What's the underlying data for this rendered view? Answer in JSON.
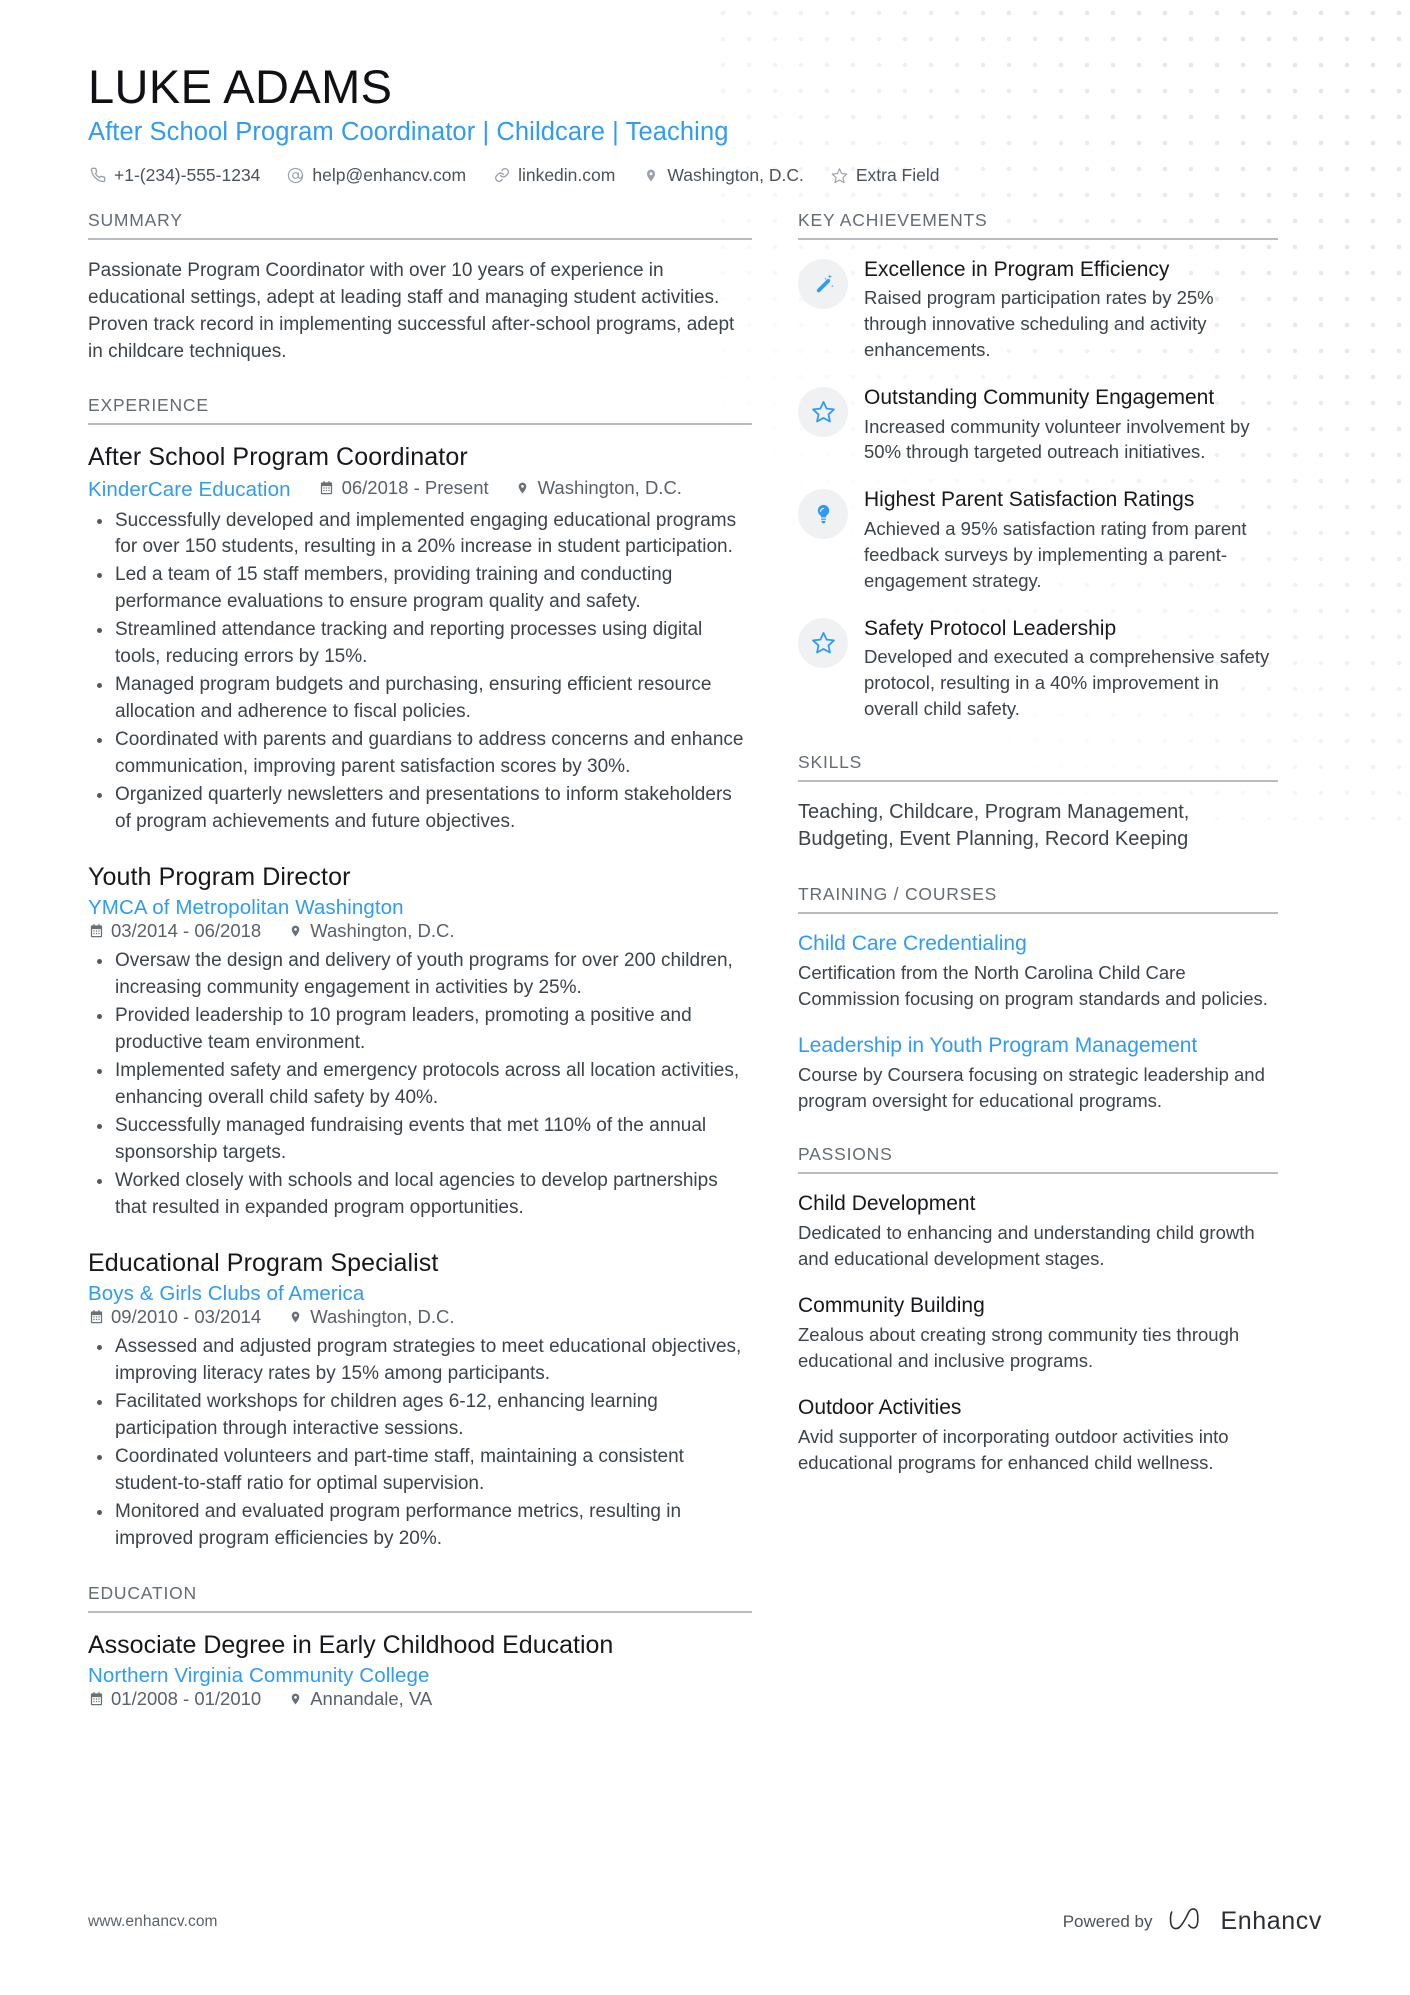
{
  "header": {
    "name": "LUKE ADAMS",
    "headline": "After School Program Coordinator | Childcare | Teaching",
    "contacts": [
      {
        "icon": "phone-icon",
        "text": "+1-(234)-555-1234"
      },
      {
        "icon": "email-icon",
        "text": "help@enhancv.com"
      },
      {
        "icon": "link-icon",
        "text": "linkedin.com"
      },
      {
        "icon": "location-icon",
        "text": "Washington, D.C."
      },
      {
        "icon": "star-icon",
        "text": "Extra Field"
      }
    ]
  },
  "summary": {
    "title": "SUMMARY",
    "text": "Passionate Program Coordinator with over 10 years of experience in educational settings, adept at leading staff and managing student activities. Proven track record in implementing successful after-school programs, adept in childcare techniques."
  },
  "experience": {
    "title": "EXPERIENCE",
    "jobs": [
      {
        "role": "After School Program Coordinator",
        "company": "KinderCare Education",
        "dates": "06/2018 - Present",
        "location": "Washington, D.C.",
        "inline_meta": true,
        "bullets": [
          "Successfully developed and implemented engaging educational programs for over 150 students, resulting in a 20% increase in student participation.",
          "Led a team of 15 staff members, providing training and conducting performance evaluations to ensure program quality and safety.",
          "Streamlined attendance tracking and reporting processes using digital tools, reducing errors by 15%.",
          "Managed program budgets and purchasing, ensuring efficient resource allocation and adherence to fiscal policies.",
          "Coordinated with parents and guardians to address concerns and enhance communication, improving parent satisfaction scores by 30%.",
          "Organized quarterly newsletters and presentations to inform stakeholders of program achievements and future objectives."
        ]
      },
      {
        "role": "Youth Program Director",
        "company": "YMCA of Metropolitan Washington",
        "dates": "03/2014 - 06/2018",
        "location": "Washington, D.C.",
        "inline_meta": false,
        "bullets": [
          "Oversaw the design and delivery of youth programs for over 200 children, increasing community engagement in activities by 25%.",
          "Provided leadership to 10 program leaders, promoting a positive and productive team environment.",
          "Implemented safety and emergency protocols across all location activities, enhancing overall child safety by 40%.",
          "Successfully managed fundraising events that met 110% of the annual sponsorship targets.",
          "Worked closely with schools and local agencies to develop partnerships that resulted in expanded program opportunities."
        ]
      },
      {
        "role": "Educational Program Specialist",
        "company": "Boys & Girls Clubs of America",
        "dates": "09/2010 - 03/2014",
        "location": "Washington, D.C.",
        "inline_meta": false,
        "bullets": [
          "Assessed and adjusted program strategies to meet educational objectives, improving literacy rates by 15% among participants.",
          "Facilitated workshops for children ages 6-12, enhancing learning participation through interactive sessions.",
          "Coordinated volunteers and part-time staff, maintaining a consistent student-to-staff ratio for optimal supervision.",
          "Monitored and evaluated program performance metrics, resulting in improved program efficiencies by 20%."
        ]
      }
    ]
  },
  "education": {
    "title": "EDUCATION",
    "entries": [
      {
        "degree": "Associate Degree in Early Childhood Education",
        "school": "Northern Virginia Community College",
        "dates": "01/2008 - 01/2010",
        "location": "Annandale, VA"
      }
    ]
  },
  "key_achievements": {
    "title": "KEY ACHIEVEMENTS",
    "items": [
      {
        "icon": "magic-wand-icon",
        "title": "Excellence in Program Efficiency",
        "text": "Raised program participation rates by 25% through innovative scheduling and activity enhancements."
      },
      {
        "icon": "star-icon",
        "title": "Outstanding Community Engagement",
        "text": "Increased community volunteer involvement by 50% through targeted outreach initiatives."
      },
      {
        "icon": "lightbulb-icon",
        "title": "Highest Parent Satisfaction Ratings",
        "text": "Achieved a 95% satisfaction rating from parent feedback surveys by implementing a parent-engagement strategy."
      },
      {
        "icon": "star-icon",
        "title": "Safety Protocol Leadership",
        "text": "Developed and executed a comprehensive safety protocol, resulting in a 40% improvement in overall child safety."
      }
    ]
  },
  "skills": {
    "title": "SKILLS",
    "text": "Teaching, Childcare, Program Management, Budgeting, Event Planning, Record Keeping"
  },
  "training": {
    "title": "TRAINING / COURSES",
    "items": [
      {
        "name": "Child Care Credentialing",
        "text": "Certification from the North Carolina Child Care Commission focusing on program standards and policies."
      },
      {
        "name": "Leadership in Youth Program Management",
        "text": "Course by Coursera focusing on strategic leadership and program oversight for educational programs."
      }
    ]
  },
  "passions": {
    "title": "PASSIONS",
    "items": [
      {
        "name": "Child Development",
        "text": "Dedicated to enhancing and understanding child growth and educational development stages."
      },
      {
        "name": "Community Building",
        "text": "Zealous about creating strong community ties through educational and inclusive programs."
      },
      {
        "name": "Outdoor Activities",
        "text": "Avid supporter of incorporating outdoor activities into educational programs for enhanced child wellness."
      }
    ]
  },
  "footer": {
    "url": "www.enhancv.com",
    "powered_by": "Powered by",
    "brand": "Enhancv"
  },
  "colors": {
    "accent": "#2f9bf5",
    "text": "#3c434a",
    "heading": "#646b72",
    "rule": "#b9bcbf",
    "icon_bg": "#f0f1f2"
  }
}
